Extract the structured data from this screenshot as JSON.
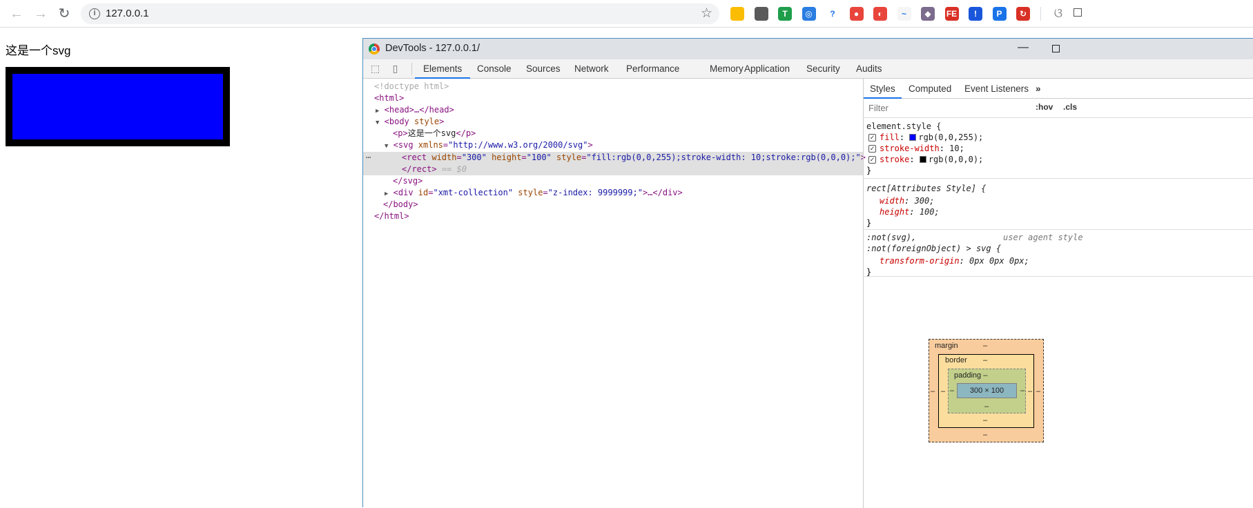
{
  "browser": {
    "url": "127.0.0.1",
    "ext_icons": [
      {
        "name": "google-drive-icon",
        "bg": "#fbbc04",
        "glyph": ""
      },
      {
        "name": "screenshot-ext-icon",
        "bg": "#5a5a5a",
        "glyph": ""
      },
      {
        "name": "shield-ext-icon",
        "bg": "#1e9e4a",
        "glyph": "T"
      },
      {
        "name": "compass-ext-icon",
        "bg": "#2a7de1",
        "glyph": "◎"
      },
      {
        "name": "help-ext-icon",
        "bg": "#ffffff",
        "glyph": "?"
      },
      {
        "name": "location-ext-icon",
        "bg": "#e8453c",
        "glyph": "●"
      },
      {
        "name": "red-circle-ext-icon",
        "bg": "#e8453c",
        "glyph": "◐"
      },
      {
        "name": "swirl-ext-icon",
        "bg": "#f5f5f5",
        "glyph": "~"
      },
      {
        "name": "cat-ext-icon",
        "bg": "#7b6b8d",
        "glyph": "◆"
      },
      {
        "name": "fe-ext-icon",
        "bg": "#d93025",
        "glyph": "FE"
      },
      {
        "name": "bookmark-ext-icon",
        "bg": "#1a56db",
        "glyph": "!"
      },
      {
        "name": "p-ext-icon",
        "bg": "#1a73e8",
        "glyph": "P"
      },
      {
        "name": "refresh-ext-icon",
        "bg": "#d93025",
        "glyph": "↻"
      }
    ]
  },
  "page": {
    "paragraph": "这是一个svg",
    "rect_fill": "#0000ff",
    "rect_stroke": "#000000"
  },
  "devtools": {
    "title": "DevTools - 127.0.0.1/",
    "tabs": [
      "Elements",
      "Console",
      "Sources",
      "Network",
      "Performance",
      "Memory",
      "Application",
      "Security",
      "Audits"
    ],
    "active_tab": "Elements",
    "dom": {
      "doctype": "<!doctype html>",
      "html_open": "<html>",
      "head": "<head>…</head>",
      "body_open_tag": "<body",
      "body_attr": " style",
      "body_close_bracket": ">",
      "p_open": "<p>",
      "p_text": "这是一个svg",
      "p_close": "</p>",
      "svg_open_tag": "<svg",
      "svg_attr_name": " xmlns",
      "svg_attr_eq": "=",
      "svg_attr_val": "\"http://www.w3.org/2000/svg\"",
      "svg_close_bracket": ">",
      "rect_open_tag": "<rect",
      "rect_w_name": " width",
      "rect_w_val": "\"300\"",
      "rect_h_name": " height",
      "rect_h_val": "\"100\"",
      "rect_s_name": " style",
      "rect_s_val": "\"fill:rgb(0,0,255);stroke-width: 10;stroke:rgb(0,0,0);\"",
      "rect_close_bracket": ">",
      "rect_close": "</rect>",
      "rect_ref": " == $0",
      "svg_close": "</svg>",
      "div_open_tag": "<div",
      "div_id_name": " id",
      "div_id_val": "\"xmt-collection\"",
      "div_style_name": " style",
      "div_style_val": "\"z-index: 9999999;\"",
      "div_rest": ">…</div>",
      "body_close": "</body>",
      "html_close": "</html>"
    },
    "styles": {
      "sub_tabs": [
        "Styles",
        "Computed",
        "Event Listeners"
      ],
      "more": "»",
      "filter_placeholder": "Filter",
      "hov": ":hov",
      "cls": ".cls",
      "element_style_selector": "element.style {",
      "element_style_props": [
        {
          "prop": "fill",
          "value": "rgb(0,0,255);",
          "swatch": "#0000ff"
        },
        {
          "prop": "stroke-width",
          "value": "10;",
          "swatch": ""
        },
        {
          "prop": "stroke",
          "value": "rgb(0,0,0);",
          "swatch": "#000000"
        }
      ],
      "close_brace": "}",
      "attr_selector": "rect[Attributes Style] {",
      "attr_props": [
        {
          "prop": "width",
          "value": "300;"
        },
        {
          "prop": "height",
          "value": "100;"
        }
      ],
      "ua_selector_1": ":not(svg),",
      "ua_label": "user agent style",
      "ua_selector_2": ":not(foreignObject) > svg {",
      "ua_prop": "transform-origin",
      "ua_value": "0px 0px 0px;"
    },
    "box_model": {
      "margin_label": "margin",
      "border_label": "border",
      "padding_label": "padding",
      "dash": "–",
      "content": "300 × 100"
    }
  }
}
